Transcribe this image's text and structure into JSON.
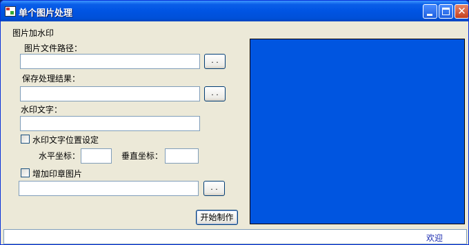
{
  "window": {
    "title": "单个图片处理"
  },
  "group": {
    "title": "图片加水印"
  },
  "image_path": {
    "label": "图片文件路径：",
    "value": "",
    "browse_label": ". ."
  },
  "save_path": {
    "label": "保存处理结果：",
    "value": "",
    "browse_label": ". ."
  },
  "watermark_text": {
    "label": "水印文字：",
    "value": ""
  },
  "position_setting": {
    "checkbox_label": "水印文字位置设定",
    "checked": false,
    "x_label": "水平坐标：",
    "x_value": "",
    "y_label": "垂直坐标：",
    "y_value": ""
  },
  "stamp_image": {
    "checkbox_label": "增加印章图片",
    "checked": false,
    "value": "",
    "browse_label": ". ."
  },
  "actions": {
    "start_label": "开始制作"
  },
  "preview": {
    "background_color": "#0055e0"
  },
  "statusbar": {
    "text": "欢迎"
  }
}
